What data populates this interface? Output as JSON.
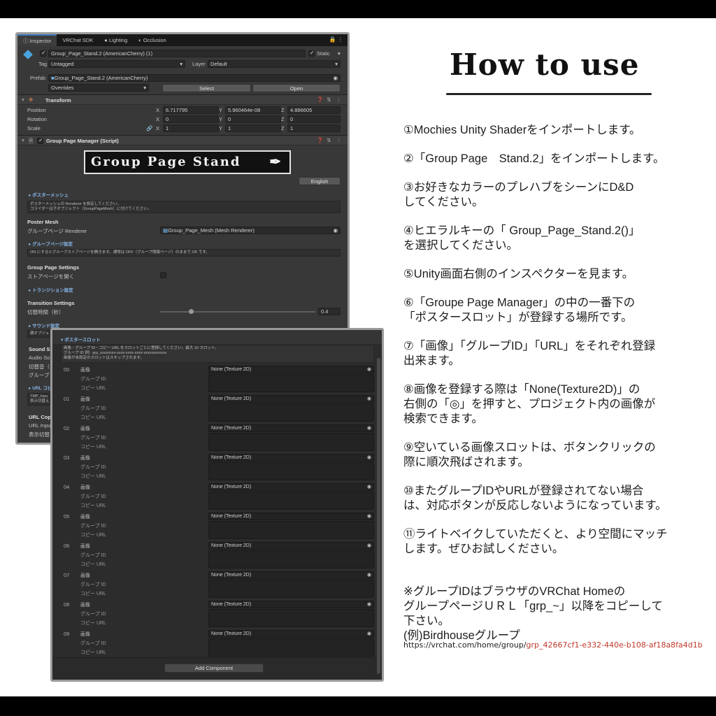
{
  "inspector": {
    "tabs": [
      "Inspector",
      "VRChat SDK",
      "Lighting",
      "Occlusion"
    ],
    "object_name": "Group_Page_Stand.2 (AmericanCherry) (1)",
    "static_label": "Static",
    "tag_label": "Tag",
    "tag_value": "Untagged",
    "layer_label": "Layer",
    "layer_value": "Default",
    "prefab_label": "Prefab",
    "prefab_value": "Group_Page_Stand.2 (AmericanCherry)",
    "overrides_label": "Overrides",
    "select_label": "Select",
    "open_label": "Open",
    "transform": {
      "title": "Transform",
      "position_label": "Position",
      "rotation_label": "Rotation",
      "scale_label": "Scale",
      "position": [
        "6.717795",
        "5.960464e-08",
        "4.886605"
      ],
      "rotation": [
        "0",
        "0",
        "0"
      ],
      "scale": [
        "1",
        "1",
        "1"
      ],
      "axes": [
        "X",
        "Y",
        "Z"
      ]
    },
    "script": {
      "title": "Group Page Manager (Script)",
      "logo_text": "Group Page Stand",
      "english_button": "English",
      "poster_mesh_section": "ポスターメッシュ",
      "poster_mesh_help_1": "ポスターメッシュの Renderer を設定してください。",
      "poster_mesh_help_2": "コライダーは子オブジェクト（GroupPageMesh）に付けてください。",
      "poster_mesh_label": "Poster Mesh",
      "group_page_renderer_label": "グループページ Renderer",
      "group_page_renderer_value": "Group_Page_Mesh (Mesh Renderer)",
      "group_page_section": "グループページ設定",
      "group_page_help": "ON にするとグループストアページを開きます。通常は OFF（グループ情報ページ）のままで OK です。",
      "group_page_settings_label": "Group Page Settings",
      "store_page_label": "ストアページを開く",
      "transition_section": "トランジション設定",
      "transition_settings_label": "Transition Settings",
      "switch_time_label": "切替時間（秒）",
      "switch_time_value": "0.4",
      "switch_time_fraction": 0.2,
      "sound_section": "サウンド設定",
      "sound_help": "親オブジェ",
      "sound_label": "Sound S",
      "audio_label": "Audio So",
      "switch_sound_label": "切替音（",
      "group_sound_label": "グループ",
      "url_section": "URL コピ",
      "tmp_help_1": "TMP_Inpu",
      "tmp_help_2": "表示切替え",
      "url_copy_label": "URL Cop",
      "url_input_label": "URL Inpu",
      "display_switch_label": "表示切替"
    }
  },
  "slots_panel": {
    "section_title": "ポスタースロット",
    "help_1": "画像・グループ ID・コピー URL をスロットごとに登録してください。最大 10 スロット。",
    "help_2": "グループ ID 例）grp_xxxxxxxx-xxxx-xxxx-xxxx-xxxxxxxxxxxx",
    "help_3": "画像が未設定のスロットはスキップされます。",
    "image_label": "画像",
    "group_id_label": "グループ ID",
    "copy_url_label": "コピー URL",
    "texture_value": "None (Texture 2D)",
    "slots": [
      "00",
      "01",
      "02",
      "03",
      "04",
      "05",
      "06",
      "07",
      "08",
      "09"
    ],
    "add_component": "Add Component"
  },
  "howto": {
    "title": "How to use",
    "steps": [
      "①Mochies Unity Shaderをインポートします。",
      "②「Group Page　Stand.2」をインポートします。",
      "③お好きなカラーのプレハブをシーンにD&D\nしてください。",
      "④ヒエラルキーの「 Group_Page_Stand.2()」\nを選択してください。",
      "⑤Unity画面右側のインスペクターを見ます。",
      "⑥「Groupe Page Manager」の中の一番下の\n「ポスタースロット」が登録する場所です。",
      "⑦「画像」「グループID」「URL」をそれぞれ登録\n出来ます。",
      "⑧画像を登録する際は「None(Texture2D)」の\n右側の「◎」を押すと、プロジェクト内の画像が\n検索できます。",
      "⑨空いている画像スロットは、ボタンクリックの\n際に順次飛ばされます。",
      "⑩またグループIDやURLが登録されてない場合\nは、対応ボタンが反応しないようになっています。",
      "⑪ライトベイクしていただくと、より空間にマッチ\nします。ぜひお試しください。"
    ],
    "note": "※グループIDはブラウザのVRChat Homeの\nグループページＵＲＬ「grp_~」以降をコピーして\n下さい。\n(例)Birdhouseグループ",
    "url_prefix": "https://vrchat.com/home/group/",
    "url_group": "grp_42667cf1-e332-440e-b108-af18a8fa4d1b"
  }
}
